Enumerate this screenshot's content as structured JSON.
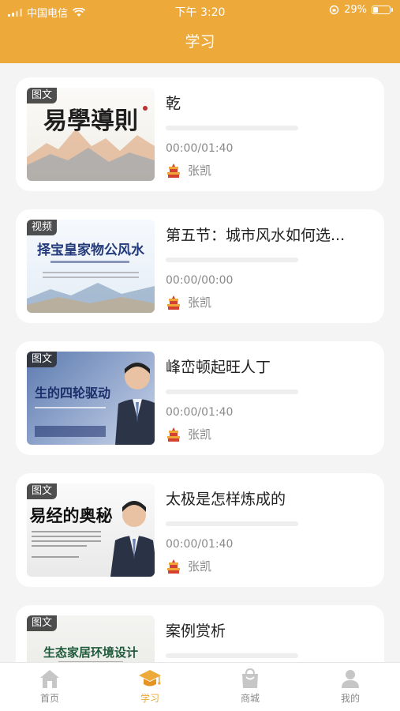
{
  "status_bar": {
    "carrier": "中国电信",
    "time": "下午 3:20",
    "battery": "29%",
    "battery_level": 0.29
  },
  "header": {
    "title": "学习"
  },
  "courses": [
    {
      "tag": "图文",
      "title": "乾",
      "time": "00:00/01:40",
      "progress": 0,
      "author": "张凯",
      "thumb_text": "易學導則"
    },
    {
      "tag": "视频",
      "title": "第五节：城市风水如何选...",
      "time": "00:00/00:00",
      "progress": 0,
      "author": "张凯",
      "thumb_text": "择宝皇家物公风水"
    },
    {
      "tag": "图文",
      "title": "峰峦顿起旺人丁",
      "time": "00:00/01:40",
      "progress": 0,
      "author": "张凯",
      "thumb_text": "生的四轮驱动"
    },
    {
      "tag": "图文",
      "title": "太极是怎样炼成的",
      "time": "00:00/01:40",
      "progress": 0,
      "author": "张凯",
      "thumb_text": "易经的奥秘"
    },
    {
      "tag": "图文",
      "title": "案例赏析",
      "time": "",
      "progress": 0,
      "author": "",
      "thumb_text": "生态家居环境设计"
    }
  ],
  "tabbar": [
    {
      "label": "首页",
      "icon": "home-icon",
      "active": false
    },
    {
      "label": "学习",
      "icon": "graduation-cap-icon",
      "active": true
    },
    {
      "label": "商城",
      "icon": "shopping-bag-icon",
      "active": false
    },
    {
      "label": "我的",
      "icon": "user-icon",
      "active": false
    }
  ],
  "colors": {
    "accent": "#eda93a",
    "background": "#f4f4f4",
    "text_secondary": "#8a8a8a"
  }
}
